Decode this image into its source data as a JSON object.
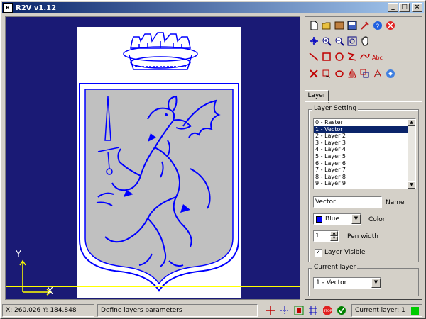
{
  "window": {
    "title": "R2V v1.12",
    "minimize": "_",
    "maximize": "□",
    "close": "×"
  },
  "canvas": {
    "axis_y": "Y",
    "axis_x": "X",
    "background_color": "#1a1a75",
    "vector_color": "#0000ff"
  },
  "toolbar": {
    "rows": [
      [
        "new-file-icon",
        "open-file-icon",
        "import-icon",
        "save-icon",
        "tool-icon",
        "help-icon",
        "exit-icon"
      ],
      [
        "pan-icon",
        "zoom-in-icon",
        "zoom-out-icon",
        "zoom-window-icon",
        "hand-icon"
      ],
      [
        "line-icon",
        "rectangle-icon",
        "circle-icon",
        "polyline-icon",
        "curve-icon",
        "text-icon"
      ],
      [
        "delete-icon",
        "move-icon",
        "rotate-icon",
        "mirror-icon",
        "copy-icon",
        "trim-icon",
        "info-icon"
      ]
    ]
  },
  "tabs": {
    "layer": "Layer"
  },
  "layer_setting": {
    "group_label": "Layer Setting",
    "layers": [
      "0 - Raster",
      "1 - Vector",
      "2 - Layer 2",
      "3 - Layer 3",
      "4 - Layer 4",
      "5 - Layer 5",
      "6 - Layer 6",
      "7 - Layer 7",
      "8 - Layer 8",
      "9 - Layer 9"
    ],
    "selected_index": 1,
    "name_value": "Vector",
    "name_label": "Name",
    "color_value": "Blue",
    "color_swatch": "#0000ff",
    "color_label": "Color",
    "pen_width_value": "1",
    "pen_width_label": "Pen width",
    "visible_label": "Layer Visible",
    "visible_checked": "✓"
  },
  "current_layer": {
    "group_label": "Current layer",
    "value": "1 - Vector"
  },
  "statusbar": {
    "coords": "X: 260.026 Y: 184.848",
    "message": "Define layers parameters",
    "current_layer": "Current layer: 1",
    "layer_color": "#00cc00",
    "tools": [
      "crosshair-icon",
      "snap-icon",
      "grid-snap-icon",
      "grid-icon",
      "stop-icon",
      "ok-icon"
    ]
  }
}
